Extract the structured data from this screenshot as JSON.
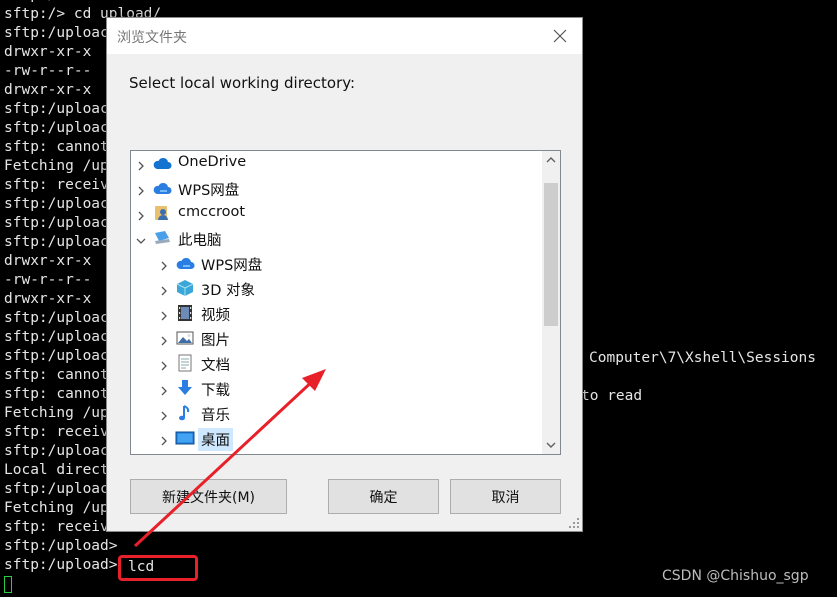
{
  "terminal": {
    "lines": [
      "sftp:/>",
      "sftp:/> cd upload/",
      "sftp:/uploac",
      "drwxr-xr-x",
      "-rw-r--r--",
      "drwxr-xr-x",
      "sftp:/uploac",
      "sftp:/uploac",
      "sftp: cannot",
      "Fetching /up",
      "sftp: receiv",
      "sftp:/uploac",
      "sftp:/uploac",
      "sftp:/uploac",
      "drwxr-xr-x",
      "-rw-r--r--",
      "drwxr-xr-x",
      "sftp:/uploac",
      "sftp:/uploac",
      "sftp:/uploac",
      "sftp: cannot",
      "sftp: cannot",
      "Fetching /up",
      "sftp: receiv",
      "sftp:/uploac",
      "Local direct",
      "sftp:/uploac",
      "Fetching /up",
      "sftp: receiv",
      "sftp:/upload>",
      "sftp:/upload>"
    ],
    "right_fragment_1": "Computer\\7\\Xshell\\Sessions",
    "right_fragment_2": "to read",
    "current_command": "lcd",
    "watermark": "CSDN @Chishuo_sgp"
  },
  "dialog": {
    "title": "浏览文件夹",
    "prompt": "Select local working directory:",
    "tree": [
      {
        "label": "OneDrive",
        "icon": "onedrive-cloud-icon",
        "level": 0,
        "expanded": false
      },
      {
        "label": "WPS网盘",
        "icon": "wps-cloud-icon",
        "level": 0,
        "expanded": false
      },
      {
        "label": "cmccroot",
        "icon": "user-folder-icon",
        "level": 0,
        "expanded": false
      },
      {
        "label": "此电脑",
        "icon": "computer-icon",
        "level": 0,
        "expanded": true
      },
      {
        "label": "WPS网盘",
        "icon": "wps-cloud-icon",
        "level": 1,
        "expanded": false
      },
      {
        "label": "3D 对象",
        "icon": "3d-objects-icon",
        "level": 1,
        "expanded": false
      },
      {
        "label": "视频",
        "icon": "video-icon",
        "level": 1,
        "expanded": false
      },
      {
        "label": "图片",
        "icon": "pictures-icon",
        "level": 1,
        "expanded": false
      },
      {
        "label": "文档",
        "icon": "documents-icon",
        "level": 1,
        "expanded": false
      },
      {
        "label": "下载",
        "icon": "downloads-icon",
        "level": 1,
        "expanded": false
      },
      {
        "label": "音乐",
        "icon": "music-icon",
        "level": 1,
        "expanded": false
      },
      {
        "label": "桌面",
        "icon": "desktop-icon",
        "level": 1,
        "expanded": false,
        "selected": true
      }
    ],
    "buttons": {
      "new_folder": "新建文件夹(M)",
      "ok": "确定",
      "cancel": "取消"
    }
  },
  "colors": {
    "terminal_bg": "#000000",
    "terminal_text": "#e6e6e6",
    "cursor": "#2ecc40",
    "annotation_red": "#e8202a",
    "selection": "#cde8ff"
  }
}
